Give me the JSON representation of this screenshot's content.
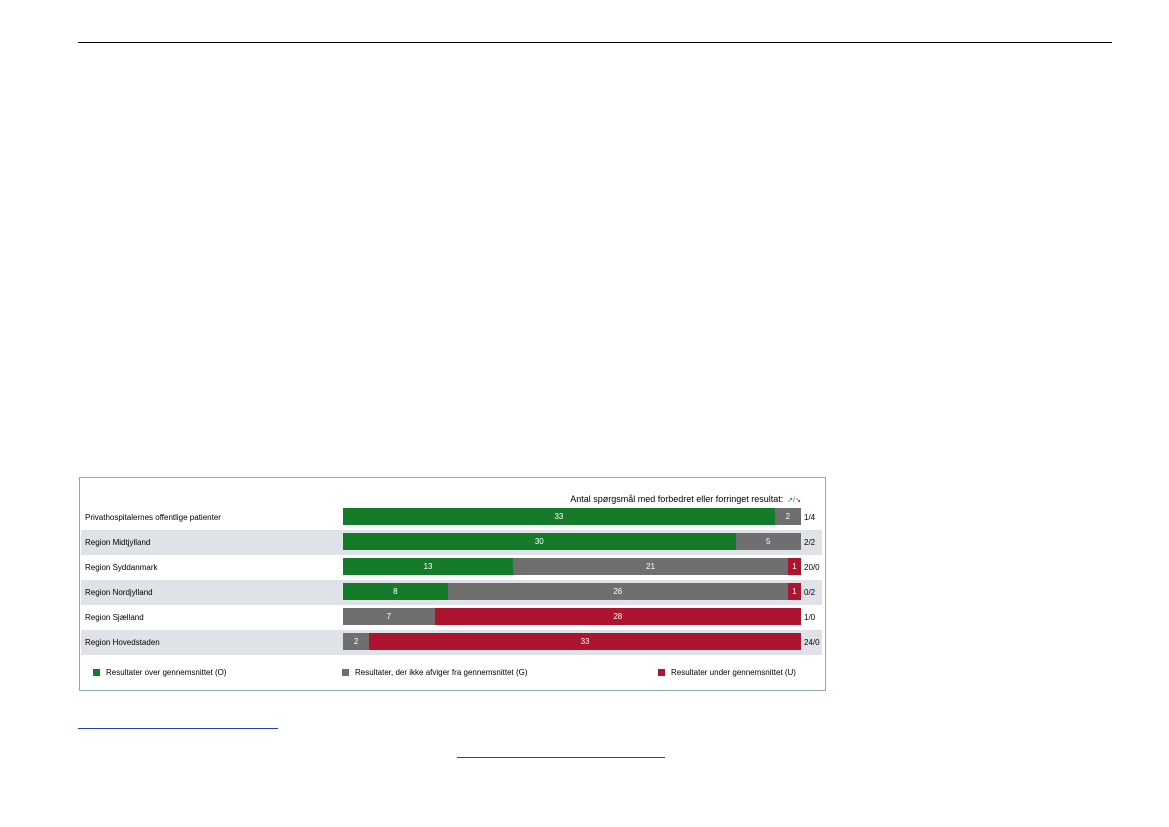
{
  "colors": {
    "over": "#157a2a",
    "neutral": "#6f6f6f",
    "under": "#ad1430",
    "frame": "#8ea7b8",
    "shade": "#dfe2e6"
  },
  "chart_data": {
    "type": "bar",
    "stacked": "horizontal",
    "header_text": "Antal spørgsmål med forbedret eller forringet resultat:",
    "header_up_symbol": "↗",
    "header_separator": "/",
    "header_down_symbol": "↘",
    "categories": [
      "Privathospitalernes offentlige patienter",
      "Region Midtjylland",
      "Region Syddanmark",
      "Region Nordjylland",
      "Region Sjælland",
      "Region Hovedstaden"
    ],
    "series": [
      {
        "name": "Resultater over gennemsnittet (O)",
        "color": "#157a2a",
        "values": [
          33,
          30,
          13,
          8,
          0,
          0
        ]
      },
      {
        "name": "Resultater, der ikke afviger fra gennemsnittet (G)",
        "color": "#6f6f6f",
        "values": [
          2,
          5,
          21,
          26,
          7,
          2
        ]
      },
      {
        "name": "Resultater under gennemsnittet (U)",
        "color": "#ad1430",
        "values": [
          0,
          0,
          1,
          1,
          28,
          33
        ]
      }
    ],
    "ratios": [
      "1/4",
      "2/2",
      "20/0",
      "0/2",
      "1/0",
      "24/0"
    ],
    "shaded_rows": [
      false,
      true,
      false,
      true,
      false,
      true
    ],
    "legend_position": "bottom"
  }
}
